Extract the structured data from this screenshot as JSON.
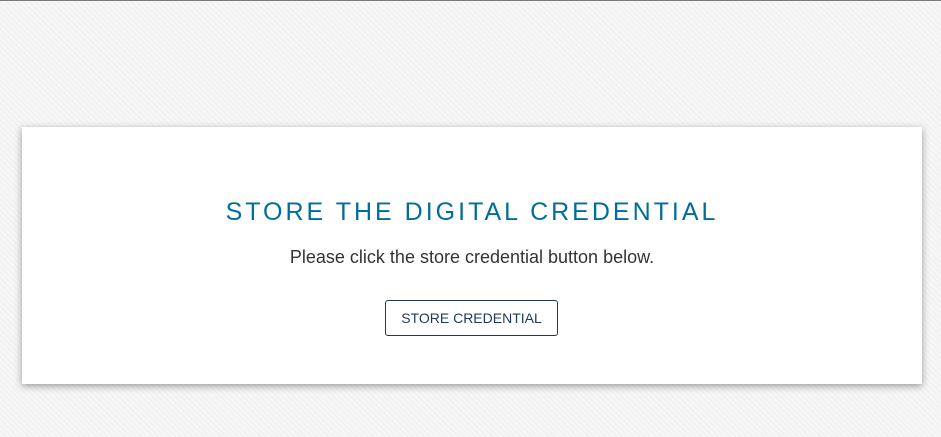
{
  "card": {
    "title": "STORE THE DIGITAL CREDENTIAL",
    "instruction": "Please click the store credential button below.",
    "button_label": "STORE CREDENTIAL"
  },
  "colors": {
    "title": "#006e9c",
    "text": "#333333",
    "button_border": "#1e3a5a",
    "page_background": "#f6f6f6",
    "card_background": "#ffffff"
  }
}
